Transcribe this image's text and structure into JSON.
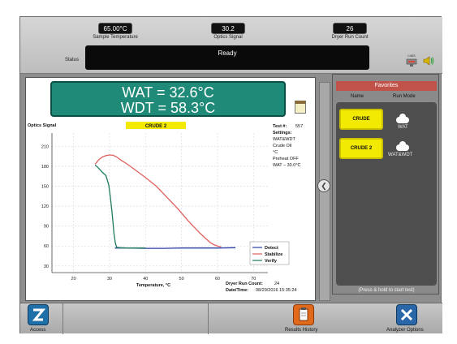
{
  "readouts": [
    {
      "value": "65.00°C",
      "label": "Sample Temperature"
    },
    {
      "value": "30.2",
      "label": "Optics Signal"
    },
    {
      "value": "26",
      "label": "Dryer Run Count"
    }
  ],
  "status": {
    "label": "Status",
    "value": "Ready"
  },
  "icons": {
    "lims": "LIMS",
    "speaker": "speaker-icon"
  },
  "result": {
    "wat": "WAT = 32.6°C",
    "wdt": "WDT = 58.3°C"
  },
  "chart_info": {
    "sample_name": "CRUDE 2",
    "test_label": "Test #:",
    "test_number": "557",
    "settings_label": "Settings:",
    "settings": [
      "WAT&WDT",
      "Crude Oil",
      "°C",
      "Preheat OFF",
      "WAT – 30.0°C"
    ],
    "dryer_label": "Dryer Run Count:",
    "dryer_value": "24",
    "date_label": "Date/Time:",
    "date_value": "08/29/2016 15:35:24"
  },
  "chart_data": {
    "type": "line",
    "ylabel": "Optics Signal",
    "xlabel": "Temperature, °C",
    "xlim": [
      14,
      74
    ],
    "ylim": [
      20,
      230
    ],
    "xticks": [
      20,
      30,
      40,
      50,
      60,
      70
    ],
    "yticks": [
      30,
      60,
      90,
      120,
      150,
      180,
      210
    ],
    "grid": true,
    "legend_position": "bottom-right",
    "series": [
      {
        "name": "Detect",
        "color": "#2b3ea8",
        "x": [
          31.5,
          35,
          40,
          45,
          50,
          55,
          60,
          65
        ],
        "y": [
          57,
          57,
          56.5,
          56.5,
          57,
          57,
          57,
          57.5
        ]
      },
      {
        "name": "Stabilize",
        "color": "#e0605e",
        "x": [
          26,
          27,
          28,
          29,
          30,
          31,
          32,
          33,
          35,
          37,
          40,
          43,
          46,
          49,
          52,
          55,
          57,
          58,
          59,
          60,
          61
        ],
        "y": [
          183,
          190,
          194,
          196,
          197,
          196.5,
          194,
          190,
          183,
          175,
          163,
          150,
          133,
          116,
          97,
          80,
          70,
          65,
          62,
          60,
          59
        ]
      },
      {
        "name": "Verify",
        "color": "#1d7a5d",
        "x": [
          26,
          27,
          28,
          29,
          29.8,
          30.3,
          30.8,
          31.2,
          31.6,
          32,
          33,
          35,
          38,
          40
        ],
        "y": [
          182,
          177,
          171,
          166,
          152,
          130,
          105,
          80,
          65,
          58,
          57.5,
          57,
          57,
          57
        ]
      }
    ]
  },
  "favorites": {
    "title": "Favorites",
    "col_name": "Name",
    "col_mode": "Run Mode",
    "items": [
      {
        "name": "CRUDE",
        "mode": "WAT"
      },
      {
        "name": "CRUDE 2",
        "mode": "WAT&WDT"
      }
    ],
    "hint": "(Press & hold to start test)"
  },
  "bottom": {
    "access": "Access",
    "results_history": "Results History",
    "analyzer_options": "Analyzer Options"
  }
}
